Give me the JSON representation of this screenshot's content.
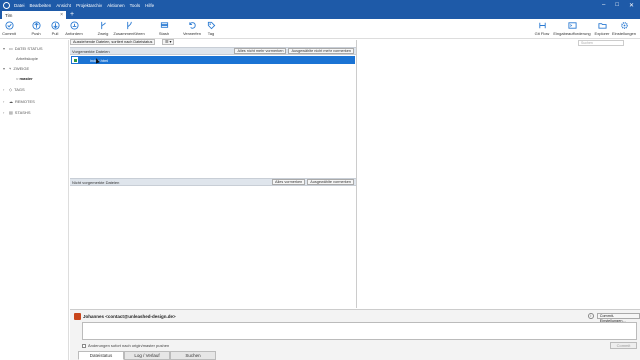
{
  "menu": [
    "Datei",
    "Bearbeiten",
    "Ansicht",
    "Projektarchiv",
    "Aktionen",
    "Tools",
    "Hilfe"
  ],
  "window_controls": {
    "minimize": "–",
    "maximize": "□",
    "close": "✕"
  },
  "tab": {
    "title": "Tim",
    "close": "×",
    "new": "+"
  },
  "toolbar": {
    "commit": "Commit",
    "push": "Push",
    "pull": "Pull",
    "fetch": "Anfordern",
    "branch": "Zweig",
    "merge": "Zusammenführen",
    "stash": "Stash",
    "discard": "Verwerfen",
    "tag": "Tag",
    "gitflow": "Git Flow",
    "terminal": "Eingabeaufforderung",
    "explorer": "Explorer",
    "settings": "Einstellungen"
  },
  "sidebar": {
    "filestatus": "DATEI STATUS",
    "workingcopy": "Arbeitskopie",
    "branches": "ZWEIGE",
    "master": "master",
    "tags": "TAGS",
    "remotes": "REMOTES",
    "stashes": "STASHS"
  },
  "filter": {
    "dropdown": "Ausstehende Dateien, sortiert nach Dateistatus",
    "search_placeholder": "Suchen"
  },
  "staged": {
    "header": "Vorgemerkte Dateien",
    "unstage_all": "Alles nicht mehr vormerken",
    "unstage_selected": "Ausgewählte nicht mehr vormerken",
    "file": "index.html"
  },
  "unstaged": {
    "header": "Nicht vorgemerkte Dateien",
    "stage_all": "Alles vormerken",
    "stage_selected": "Ausgewählte vormerken"
  },
  "commit": {
    "author": "Johannes <contact@unleashed-design.de>",
    "push_label": "Änderungen sofort nach origin/master pushen",
    "button": "Commit",
    "options": "Commit-Einstellungen..."
  },
  "bottom_tabs": [
    "Dateistatus",
    "Log / Verlauf",
    "Suchen"
  ]
}
